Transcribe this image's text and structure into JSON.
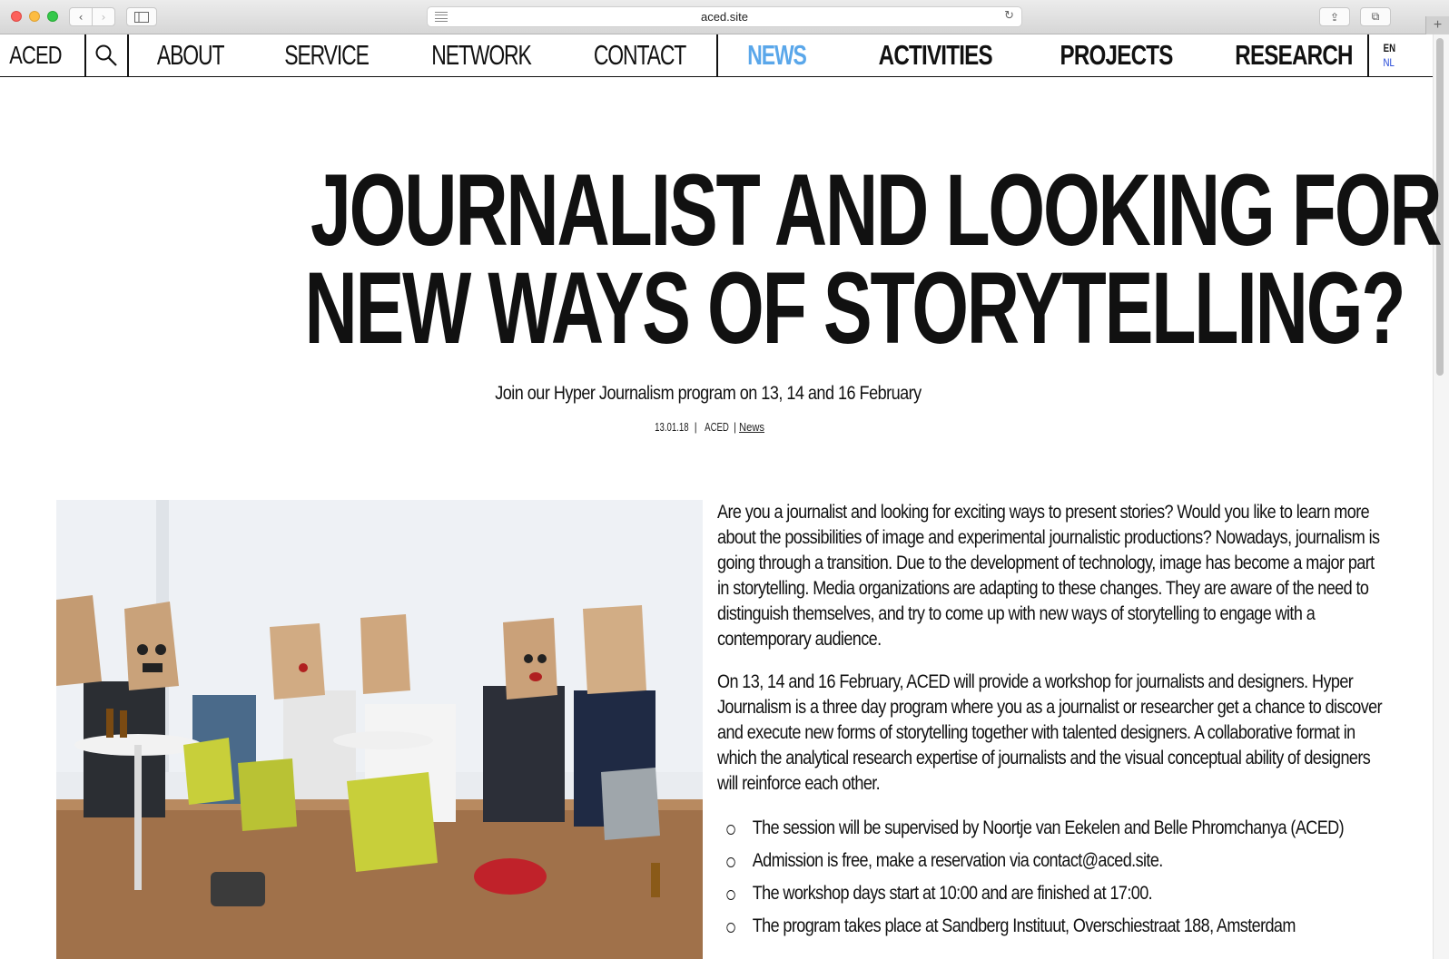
{
  "browser": {
    "url": "aced.site",
    "back_icon": "‹",
    "forward_icon": "›",
    "reload_icon": "↻",
    "share_icon": "⇪",
    "tabs_icon": "⧉",
    "new_tab_icon": "+"
  },
  "nav": {
    "logo": "ACED",
    "items": [
      {
        "label": "ABOUT",
        "style": "light"
      },
      {
        "label": "SERVICE",
        "style": "light"
      },
      {
        "label": "NETWORK",
        "style": "light"
      },
      {
        "label": "CONTACT",
        "style": "light"
      },
      {
        "label": "NEWS",
        "style": "active"
      },
      {
        "label": "ACTIVITIES",
        "style": "bold"
      },
      {
        "label": "PROJECTS",
        "style": "bold"
      },
      {
        "label": "RESEARCH",
        "style": "bold"
      }
    ],
    "lang_en": "EN",
    "lang_nl": "NL",
    "active_color": "#5aa7ea"
  },
  "article": {
    "title_line1": "JOURNALIST AND LOOKING FOR",
    "title_line2": "NEW WAYS OF STORYTELLING?",
    "subtitle": "Join our Hyper Journalism program on 13, 14 and 16 February",
    "date": "13.01.18",
    "author": "ACED",
    "category": "News",
    "paragraph1": "Are you a journalist and looking for exciting ways to present stories? Would you like to learn more about the possibilities of image and experimental journalistic productions? Nowadays, journalism is going through a transition. Due to the development of technology, image has become a major part in storytelling. Media organizations are adapting to these changes. They are aware of the need to distinguish themselves, and try to come up with new ways of storytelling to engage with a contemporary audience.",
    "paragraph2": "On 13, 14 and 16 February, ACED will provide a workshop for journalists and designers. Hyper Journalism is a three day program where you as a journalist or researcher get a chance to discover and execute new forms of storytelling together with talented designers. A collaborative format in which the analytical research expertise of journalists and the visual conceptual ability of designers will reinforce each other.",
    "bullets": [
      "The session will be supervised by Noortje van Eekelen and Belle Phromchanya (ACED)",
      "Admission is free, make a reservation via contact@aced.site.",
      "The workshop days start at 10:00 and are finished at 17:00.",
      "The program takes place at Sandberg Instituut, Overschiestraat 188, Amsterdam"
    ]
  }
}
